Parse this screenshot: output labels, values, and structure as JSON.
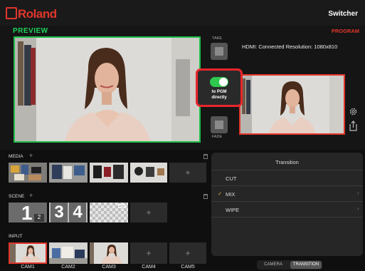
{
  "header": {
    "brand": "Roland",
    "title": "Switcher"
  },
  "preview": {
    "label": "PREVIEW"
  },
  "program": {
    "label": "PROGRAM",
    "hdmi_status": "HDMI:  Connected  Resolution: 1080x810"
  },
  "controls": {
    "take_label": "TAKE",
    "fade_label": "FADE",
    "direct_label_1": "to PGM",
    "direct_label_2": "directly",
    "direct_enabled": true
  },
  "media": {
    "label": "MEDIA"
  },
  "scene": {
    "label": "SCENE",
    "scene1_main": "1",
    "scene1_sub": "2",
    "scene2_a": "3",
    "scene2_b": "4",
    "scene3_tag": "LFG"
  },
  "input": {
    "label": "INPUT",
    "cams": [
      "CAM1",
      "CAM2",
      "CAM3",
      "CAM4",
      "CAM5"
    ]
  },
  "transition": {
    "title": "Transition",
    "items": [
      {
        "label": "CUT",
        "selected": false,
        "has_chevron": false
      },
      {
        "label": "MIX",
        "selected": true,
        "has_chevron": true
      },
      {
        "label": "WIPE",
        "selected": false,
        "has_chevron": true
      }
    ],
    "check_mark": "✓",
    "chevron": "›"
  },
  "tabs": {
    "camera": "CAMERA",
    "transition": "TRANSITION",
    "active": "TRANSITION"
  },
  "colors": {
    "accent_red": "#e0362c",
    "preview_green": "#1fbf4a",
    "toggle_green": "#2ec84f"
  }
}
